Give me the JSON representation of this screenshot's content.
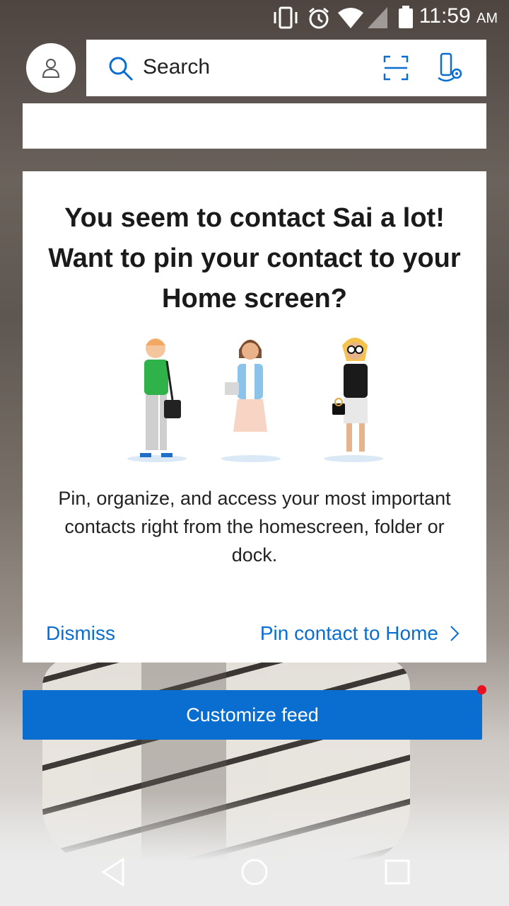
{
  "status_bar": {
    "time": "11:59",
    "ampm": "AM",
    "icons": [
      "vibrate-icon",
      "alarm-icon",
      "wifi-icon",
      "signal-icon",
      "battery-icon"
    ]
  },
  "header": {
    "avatar_icon": "person-icon",
    "search_label": "Search",
    "search_icon": "search-icon",
    "scan_icon": "scan-icon",
    "mic_icon": "voice-search-icon"
  },
  "pin_card": {
    "title": "You seem to contact Sai a lot! Want to pin your contact to your Home screen?",
    "description": "Pin, organize, and access your most important contacts right from the homescreen, folder or dock.",
    "dismiss_label": "Dismiss",
    "pin_label": "Pin contact to Home"
  },
  "customize_feed_label": "Customize feed",
  "colors": {
    "accent": "#0a6ed1",
    "notification_dot": "#e81123"
  },
  "nav_bar": {
    "icons": [
      "back-icon",
      "home-icon",
      "recents-icon"
    ]
  }
}
